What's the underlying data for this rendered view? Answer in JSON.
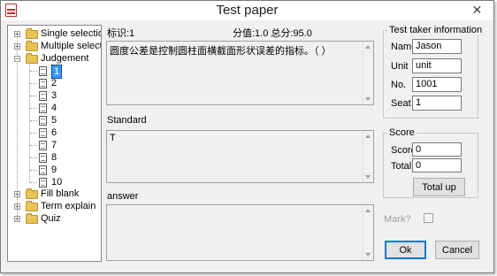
{
  "window": {
    "title": "Test paper",
    "close_glyph": "✕"
  },
  "tree": {
    "items": [
      {
        "label": "Single selection",
        "expander": "+"
      },
      {
        "label": "Multiple selection",
        "expander": "+"
      },
      {
        "label": "Judgement",
        "expander": "−"
      },
      {
        "label": "Fill blank",
        "expander": "+"
      },
      {
        "label": "Term explain",
        "expander": "+"
      },
      {
        "label": "Quiz",
        "expander": "+"
      }
    ],
    "judgement_children": [
      "1",
      "2",
      "3",
      "4",
      "5",
      "6",
      "7",
      "8",
      "9",
      "10"
    ],
    "selected_child": "1"
  },
  "question": {
    "id_label": "标识:1",
    "score_label": "分值:1.0 总分:95.0",
    "text": "圆度公差是控制圆柱面横截面形状误差的指标。（  ）"
  },
  "standard": {
    "label": "Standard",
    "value": "T"
  },
  "answer": {
    "label": "answer",
    "value": ""
  },
  "taker_info": {
    "title": "Test taker information",
    "name_label": "Name",
    "name_value": "Jason",
    "unit_label": "Unit",
    "unit_value": "unit",
    "no_label": "No.",
    "no_value": "1001",
    "seat_label": "Seat",
    "seat_value": "1"
  },
  "score": {
    "title": "Score",
    "score_label": "Score",
    "score_value": "0",
    "total_label": "Total",
    "total_value": "0",
    "total_up_label": "Total up"
  },
  "mark": {
    "label": "Mark?"
  },
  "buttons": {
    "ok_label": "Ok",
    "cancel_label": "Cancel"
  }
}
